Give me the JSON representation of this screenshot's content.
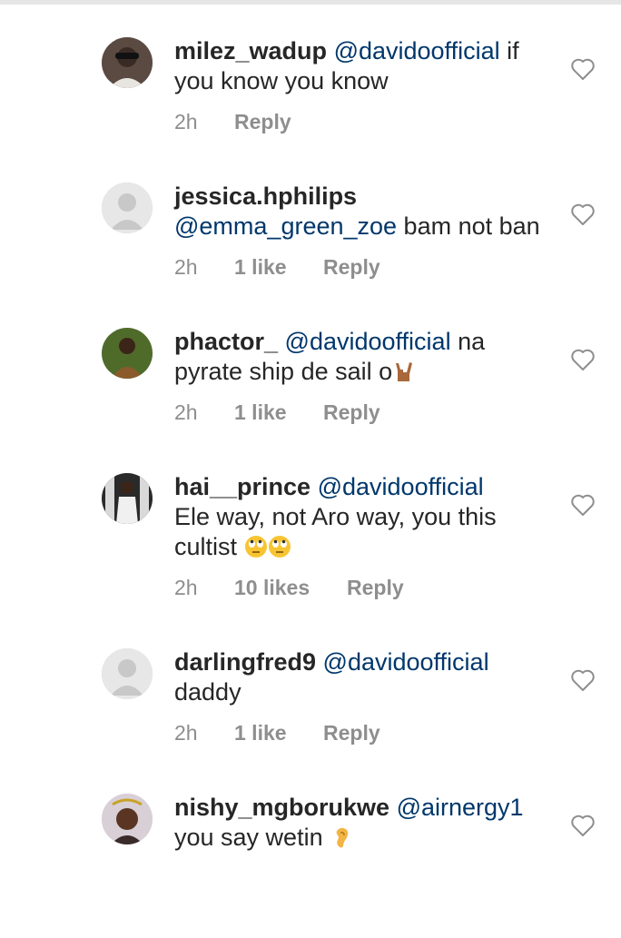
{
  "comments": [
    {
      "username": "milez_wadup",
      "mention": "@davidoofficial",
      "text": " if you know you know",
      "time": "2h",
      "likes": "",
      "reply": "Reply",
      "avatar": "photo"
    },
    {
      "username": "jessica.hphilips",
      "mention": "@emma_green_zoe",
      "text": " bam not ban",
      "time": "2h",
      "likes": "1 like",
      "reply": "Reply",
      "avatar": "default"
    },
    {
      "username": "phactor_",
      "mention": "@davidoofficial",
      "text": " na pyrate ship de sail o",
      "emoji": "sign-of-horns-emoji",
      "time": "2h",
      "likes": "1 like",
      "reply": "Reply",
      "avatar": "photo"
    },
    {
      "username": "hai__prince",
      "mention": "@davidoofficial",
      "text": " Ele way,  not Aro way,  you this cultist ",
      "emoji": "face-with-rolling-eyes-emoji",
      "time": "2h",
      "likes": "10 likes",
      "reply": "Reply",
      "avatar": "photo"
    },
    {
      "username": "darlingfred9",
      "mention": "@davidoofficial",
      "text": " daddy",
      "time": "2h",
      "likes": "1 like",
      "reply": "Reply",
      "avatar": "default"
    },
    {
      "username": "nishy_mgborukwe",
      "mention": "@airnergy1",
      "text": " you say wetin ",
      "emoji": "ear-emoji",
      "time": "",
      "likes": "",
      "reply": "",
      "avatar": "photo"
    }
  ],
  "icons": {
    "like": "heart-outline-icon",
    "default_avatar": "default-avatar-icon"
  },
  "colors": {
    "text": "#262626",
    "mention": "#00376b",
    "meta": "#8e8e8e",
    "avatar_default": "#c8c8c8"
  }
}
